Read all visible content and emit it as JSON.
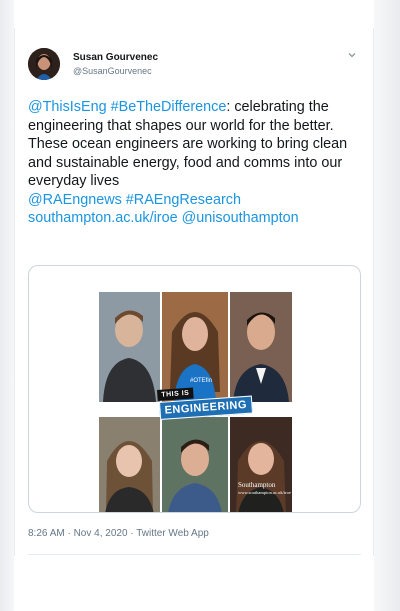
{
  "tweet": {
    "author": {
      "name": "Susan Gourvenec",
      "handle": "@SusanGourvenec"
    },
    "text": {
      "line1_link": "@ThisIsEng #BeTheDifference",
      "line1_rest": ": celebrating the engineering that shapes our world for the better. These ocean engineers are working to bring clean and sustainable energy, food and comms into our everyday lives",
      "links_line": "@RAEngnews #RAEngResearch southampton.ac.uk/iroe @unisouthampton"
    },
    "media": {
      "badge_top": "THIS IS",
      "badge_main": "ENGINEERING",
      "hashtag": "#OTEfin",
      "watermark_line1": "Southampton",
      "watermark_line2": "www.southampton.ac.uk/iroe"
    },
    "timestamp": "8:26 AM · Nov 4, 2020 · Twitter Web App"
  },
  "colors": {
    "link": "#1b95e0",
    "text": "#14171a",
    "muted": "#657786",
    "badge_blue": "#1f6fb5"
  },
  "icons": {
    "menu": "chevron-down-icon"
  }
}
